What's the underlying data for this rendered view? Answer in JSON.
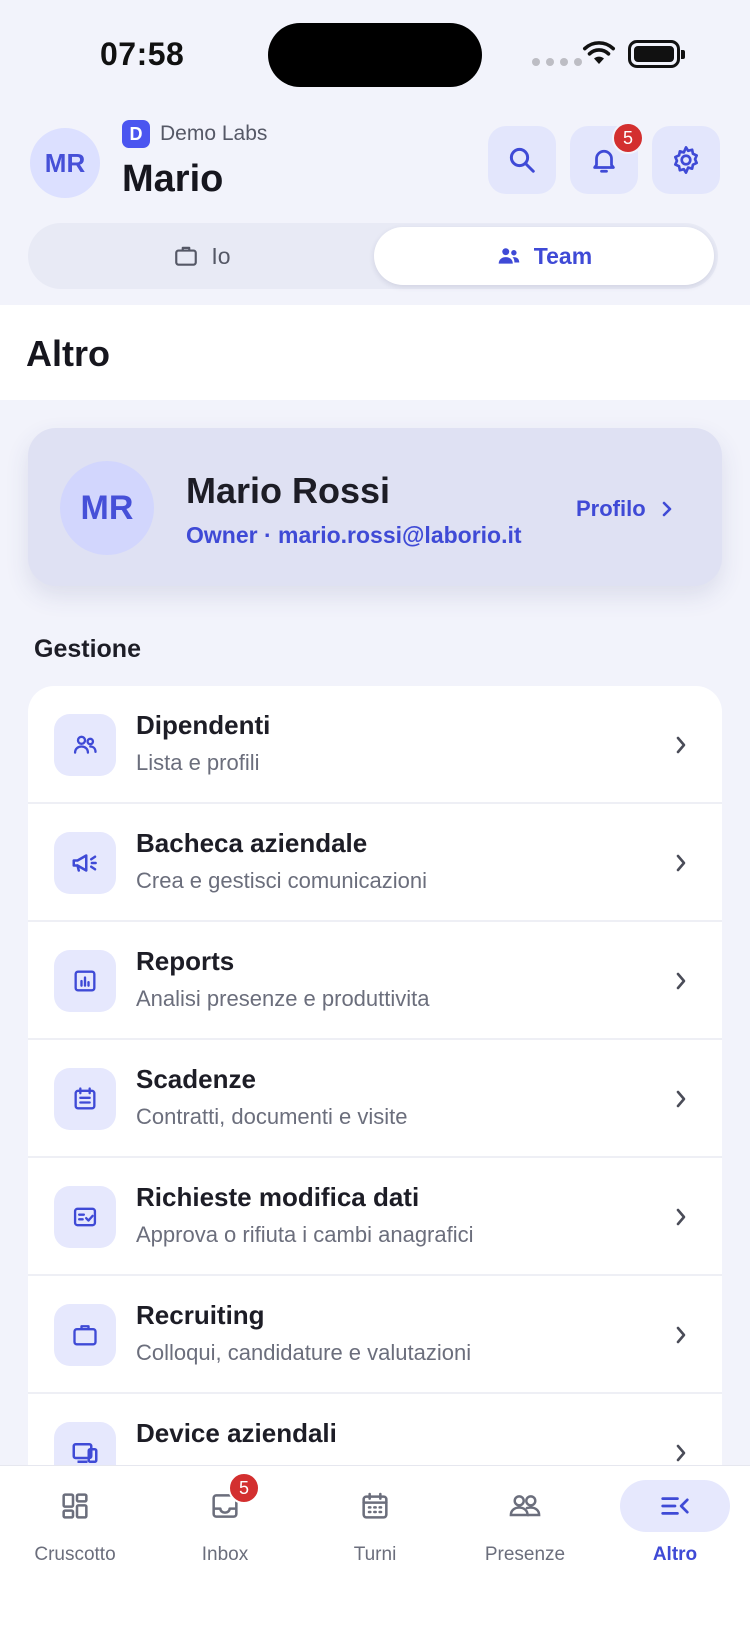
{
  "status_bar": {
    "time": "07:58"
  },
  "header": {
    "avatar_initials": "MR",
    "org_initial": "D",
    "org_name": "Demo Labs",
    "user_first_name": "Mario",
    "notifications_count": "5"
  },
  "segment": {
    "io_label": "Io",
    "team_label": "Team",
    "selected": "Team"
  },
  "section_title": "Altro",
  "profile_card": {
    "initials": "MR",
    "name": "Mario Rossi",
    "subtitle": "Owner · mario.rossi@laborio.it",
    "link_label": "Profilo"
  },
  "group_title": "Gestione",
  "menu_items": [
    {
      "title": "Dipendenti",
      "subtitle": "Lista e profili",
      "icon": "users-icon"
    },
    {
      "title": "Bacheca aziendale",
      "subtitle": "Crea e gestisci comunicazioni",
      "icon": "megaphone-icon"
    },
    {
      "title": "Reports",
      "subtitle": "Analisi presenze e produttivita",
      "icon": "chart-icon"
    },
    {
      "title": "Scadenze",
      "subtitle": "Contratti, documenti e visite",
      "icon": "calendar-list-icon"
    },
    {
      "title": "Richieste modifica dati",
      "subtitle": "Approva o rifiuta i cambi anagrafici",
      "icon": "checklist-icon"
    },
    {
      "title": "Recruiting",
      "subtitle": "Colloqui, candidature e valutazioni",
      "icon": "briefcase-icon"
    },
    {
      "title": "Device aziendali",
      "subtitle": "",
      "icon": "devices-icon"
    }
  ],
  "tab_bar": {
    "tabs": [
      {
        "label": "Cruscotto",
        "icon": "dashboard-icon"
      },
      {
        "label": "Inbox",
        "icon": "inbox-icon",
        "badge": "5"
      },
      {
        "label": "Turni",
        "icon": "calendar-icon"
      },
      {
        "label": "Presenze",
        "icon": "people-icon"
      },
      {
        "label": "Altro",
        "icon": "menu-icon"
      }
    ],
    "active": "Altro"
  },
  "colors": {
    "accent": "#3F4AD6",
    "accent_soft": "#E6E8FD",
    "badge": "#D32F2F",
    "background": "#F2F3FB"
  }
}
